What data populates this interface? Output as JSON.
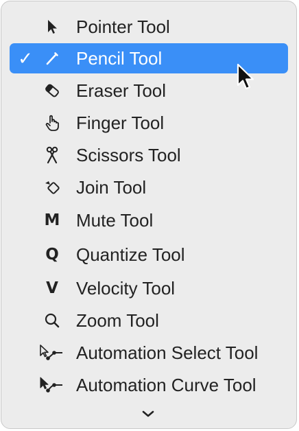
{
  "menu": {
    "items": [
      {
        "label": "Pointer Tool",
        "icon": "pointer-icon"
      },
      {
        "label": "Pencil Tool",
        "icon": "pencil-icon",
        "selected": true,
        "checkmark": "✓"
      },
      {
        "label": "Eraser Tool",
        "icon": "eraser-icon"
      },
      {
        "label": "Finger Tool",
        "icon": "finger-icon"
      },
      {
        "label": "Scissors Tool",
        "icon": "scissors-icon"
      },
      {
        "label": "Join Tool",
        "icon": "join-icon"
      },
      {
        "label": "Mute Tool",
        "icon": "mute-icon",
        "glyph": "M"
      },
      {
        "label": "Quantize Tool",
        "icon": "quantize-icon",
        "glyph": "Q"
      },
      {
        "label": "Velocity Tool",
        "icon": "velocity-icon",
        "glyph": "V"
      },
      {
        "label": "Zoom Tool",
        "icon": "zoom-icon"
      },
      {
        "label": "Automation Select Tool",
        "icon": "automation-select-icon"
      },
      {
        "label": "Automation Curve Tool",
        "icon": "automation-curve-icon"
      }
    ],
    "more_indicator": "chevron-down-icon"
  },
  "colors": {
    "menu_background": "#ececec",
    "selection": "#3a8ff7",
    "text": "#222222",
    "selected_text": "#ffffff"
  }
}
